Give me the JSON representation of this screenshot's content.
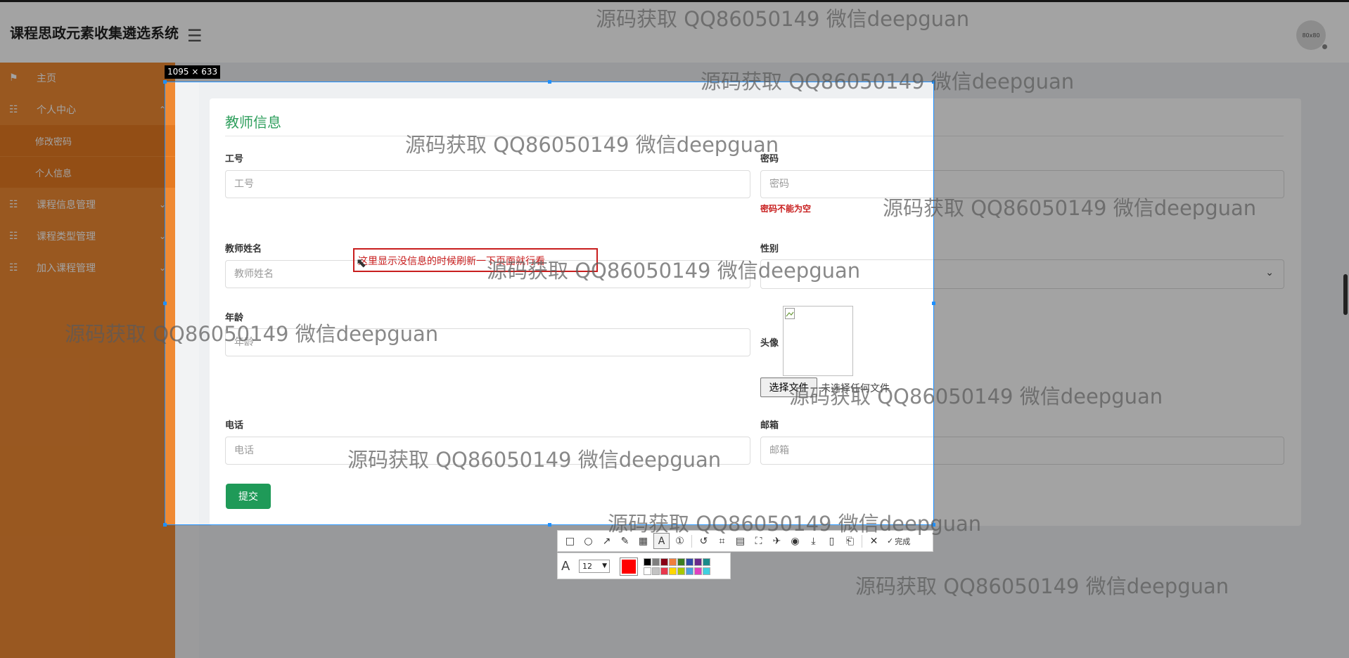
{
  "app": {
    "title": "课程思政元素收集遴选系统",
    "menu_icon": "hamburger-icon",
    "avatar_text": "80x80"
  },
  "sidebar": {
    "items": [
      {
        "label": "主页",
        "icon": "flag-icon",
        "has_arrow": false
      },
      {
        "label": "个人中心",
        "icon": "grid-icon",
        "has_arrow": true
      },
      {
        "label": "修改密码",
        "sub": true
      },
      {
        "label": "个人信息",
        "sub": true
      },
      {
        "label": "课程信息管理",
        "icon": "grid-icon",
        "has_arrow": true
      },
      {
        "label": "课程类型管理",
        "icon": "grid-icon",
        "has_arrow": true
      },
      {
        "label": "加入课程管理",
        "icon": "grid-icon",
        "has_arrow": true
      }
    ],
    "bg_color": "#f08a33"
  },
  "form": {
    "title": "教师信息",
    "fields": {
      "gonghao": {
        "label": "工号",
        "placeholder": "工号"
      },
      "mima": {
        "label": "密码",
        "placeholder": "密码",
        "error": "密码不能为空"
      },
      "xingming": {
        "label": "教师姓名",
        "placeholder": "教师姓名"
      },
      "xingbie": {
        "label": "性别"
      },
      "nianling": {
        "label": "年龄",
        "placeholder": "年龄"
      },
      "touxiang": {
        "label": "头像",
        "choose_button": "选择文件",
        "no_file": "未选择任何文件"
      },
      "dianhua": {
        "label": "电话",
        "placeholder": "电话"
      },
      "youxiang": {
        "label": "邮箱",
        "placeholder": "邮箱"
      }
    },
    "submit_label": "提交",
    "accent_color": "#2f9f5d",
    "error_color": "#c81e1e"
  },
  "screenshot_tool": {
    "size_label": "1095 × 633",
    "annotation_text": "这里显示没信息的时候刷新一下页面就行看",
    "done_label": "完成",
    "font_size": "12",
    "current_color": "#ff0000",
    "palette_row1": [
      "#000000",
      "#7f7f7f",
      "#880015",
      "#f07f3c",
      "#3a7d22",
      "#2f4aa8",
      "#6a2a8c",
      "#1a8a8a"
    ],
    "palette_row2": [
      "#ffffff",
      "#c3c3c3",
      "#e8384d",
      "#ffd700",
      "#a8c800",
      "#4aa0e0",
      "#e040c0",
      "#40d0e0"
    ],
    "tools": [
      "rectangle-icon",
      "ellipse-icon",
      "arrow-icon",
      "pencil-icon",
      "mosaic-icon",
      "text-icon",
      "number-marker-icon",
      "undo-icon",
      "crop-icon",
      "ocr-icon",
      "scan-icon",
      "pin-icon",
      "record-icon",
      "download-icon",
      "save-icon",
      "bookmark-icon",
      "close-icon",
      "check-icon"
    ]
  },
  "watermark": {
    "text": "源码获取 QQ86050149 微信deepguan"
  }
}
